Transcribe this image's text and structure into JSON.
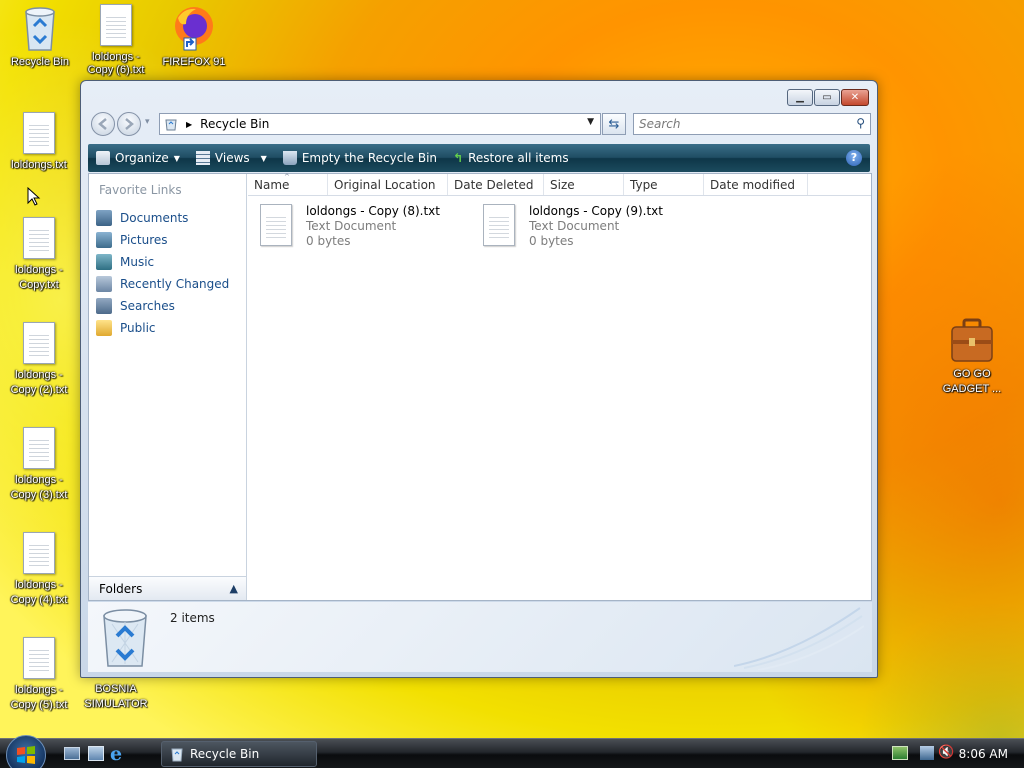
{
  "desktop": {
    "icons": [
      {
        "label": "Recycle Bin"
      },
      {
        "label": "loldongs - Copy (6).txt"
      },
      {
        "label": "FIREFOX 91"
      },
      {
        "label": "loldongs.txt"
      },
      {
        "label": "loldongs - Copy.txt"
      },
      {
        "label": "loldongs - Copy (2).txt"
      },
      {
        "label": "loldongs - Copy (3).txt"
      },
      {
        "label": "loldongs - Copy (4).txt"
      },
      {
        "label": "loldongs - Copy (5).txt"
      },
      {
        "label": "BOSNIA SIMULATOR"
      },
      {
        "label": "GO GO GADGET ..."
      }
    ]
  },
  "window": {
    "address": "Recycle Bin",
    "search_placeholder": "Search",
    "toolbar": {
      "organize": "Organize",
      "views": "Views",
      "empty": "Empty the Recycle Bin",
      "restore": "Restore all items",
      "help": "?"
    },
    "nav": {
      "heading": "Favorite Links",
      "items": [
        {
          "label": "Documents",
          "icon": "documents-icon"
        },
        {
          "label": "Pictures",
          "icon": "pictures-icon"
        },
        {
          "label": "Music",
          "icon": "music-icon"
        },
        {
          "label": "Recently Changed",
          "icon": "recently-changed-icon"
        },
        {
          "label": "Searches",
          "icon": "searches-icon"
        },
        {
          "label": "Public",
          "icon": "public-folder-icon"
        }
      ],
      "folders": "Folders"
    },
    "columns": [
      "Name",
      "Original Location",
      "Date Deleted",
      "Size",
      "Type",
      "Date modified"
    ],
    "files": [
      {
        "name": "loldongs - Copy (8).txt",
        "type": "Text Document",
        "size": "0 bytes"
      },
      {
        "name": "loldongs - Copy (9).txt",
        "type": "Text Document",
        "size": "0 bytes"
      }
    ],
    "details": {
      "count": "2 items"
    }
  },
  "taskbar": {
    "task_label": "Recycle Bin",
    "clock": "8:06 AM"
  },
  "colors": {
    "toolbar": "#1f4d63",
    "link": "#1a4e8a",
    "taskbar": "#141719"
  }
}
